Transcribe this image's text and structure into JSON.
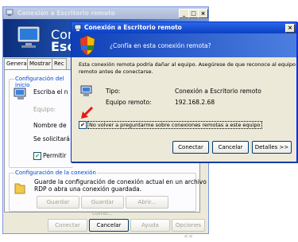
{
  "bg_window": {
    "title": "Conexión a Escritorio remoto",
    "banner_line1": "Cone",
    "banner_line2": "Escr",
    "tabs": [
      "General",
      "Mostrar",
      "Rec"
    ],
    "login_group_legend": "Configuración del inicio",
    "login_prompt": "Escriba el n",
    "login_disabled": "Equipo:",
    "username_label": "Nombre de",
    "prompt_note": "Se solicitará",
    "allow_checkbox_label": "Permitir",
    "connection_group_legend": "Configuración de la conexión",
    "connection_desc_line1": "Guarde la configuración de conexión actual en un archivo",
    "connection_desc_line2": "RDP o abra una conexión guardada.",
    "save_button": "Guardar",
    "save_as_button": "Guardar como...",
    "open_button": "Abrir...",
    "footer_buttons": [
      "Conectar",
      "Cancelar",
      "Ayuda",
      "Opciones <<"
    ]
  },
  "dialog": {
    "title": "Conexión a Escritorio remoto",
    "question": "¿Confía en esta conexión remota?",
    "warning_line1": "Esta conexión remota podría dañar al equipo. Asegúrese de que reconoce al equipo",
    "warning_line2": "remoto antes de conectarse.",
    "type_label": "Tipo:",
    "type_value": "Conexión a Escritorio remoto",
    "computer_label": "Equipo remoto:",
    "computer_value": "192.168.2.68",
    "dont_ask_label": "No volver a preguntarme sobre conexiones remotas a este equipo",
    "dont_ask_checked": true,
    "connect_button": "Conectar",
    "cancel_button": "Cancelar",
    "details_button": "Detalles >>"
  },
  "colors": {
    "annotation_arrow": "#e41b17",
    "xp_blue": "#0a3fc4"
  }
}
